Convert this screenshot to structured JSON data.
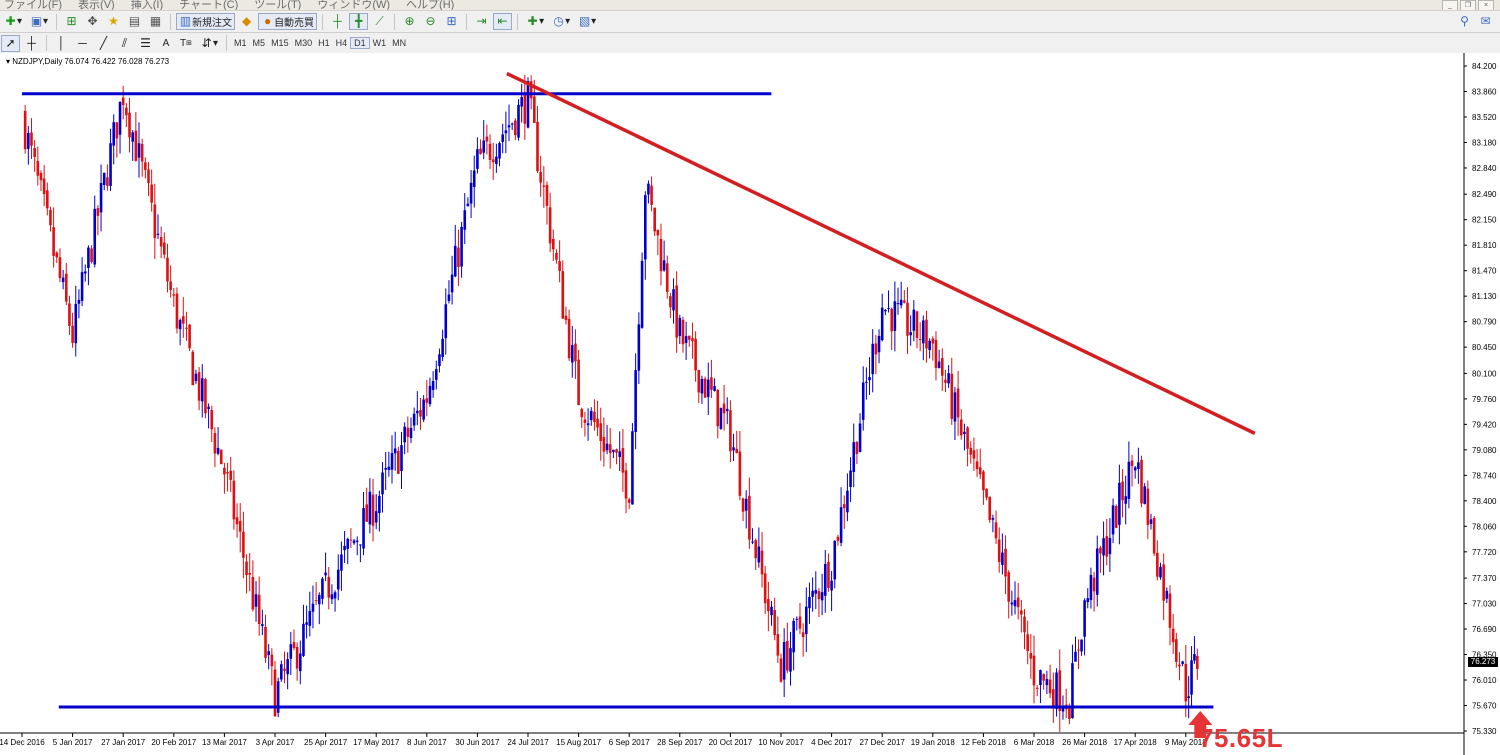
{
  "menu": [
    "ファイル(F)",
    "表示(V)",
    "挿入(I)",
    "チャート(C)",
    "ツール(T)",
    "ウィンドウ(W)",
    "ヘルプ(H)"
  ],
  "toolbar": {
    "new_order_label": "新規注文",
    "auto_trade_label": "自動売買"
  },
  "drawing_tools": {
    "text_tool_label": "A",
    "text_label_tool_label": "T"
  },
  "timeframes": [
    "M1",
    "M5",
    "M15",
    "M30",
    "H1",
    "H4",
    "D1",
    "W1",
    "MN"
  ],
  "active_timeframe": "D1",
  "chart_header": {
    "symbol_info": "NZDJPY,Daily  76.074 76.422 76.028 76.273"
  },
  "current_price_tag": "76.273",
  "annotation": {
    "text": "75.65L",
    "color": "#e53435"
  },
  "colors": {
    "bull_candle": "#0000cd",
    "bear_candle": "#dd1111",
    "support_resistance_line": "#0000cd",
    "trend_line": "#d41f22"
  },
  "chart_data": {
    "type": "candlestick",
    "symbol": "NZDJPY",
    "timeframe": "Daily",
    "ohlc_header": {
      "open": 76.074,
      "high": 76.422,
      "low": 76.028,
      "close": 76.273
    },
    "ylim": [
      75.33,
      84.2
    ],
    "y_ticks": [
      "84.200",
      "83.860",
      "83.520",
      "83.180",
      "82.840",
      "82.490",
      "82.150",
      "81.810",
      "81.470",
      "81.130",
      "80.790",
      "80.450",
      "80.100",
      "79.760",
      "79.420",
      "79.080",
      "78.740",
      "78.400",
      "78.060",
      "77.720",
      "77.370",
      "77.030",
      "76.690",
      "76.350",
      "76.010",
      "75.670",
      "75.330"
    ],
    "x_ticks": [
      "14 Dec 2016",
      "5 Jan 2017",
      "27 Jan 2017",
      "20 Feb 2017",
      "13 Mar 2017",
      "3 Apr 2017",
      "25 Apr 2017",
      "17 May 2017",
      "8 Jun 2017",
      "30 Jun 2017",
      "24 Jul 2017",
      "15 Aug 2017",
      "6 Sep 2017",
      "28 Sep 2017",
      "20 Oct 2017",
      "10 Nov 2017",
      "4 Dec 2017",
      "27 Dec 2017",
      "19 Jan 2018",
      "12 Feb 2018",
      "6 Mar 2018",
      "26 Mar 2018",
      "17 Apr 2018",
      "9 May 2018"
    ],
    "swing_points": [
      {
        "date": "14 Dec 2016",
        "price": 83.55
      },
      {
        "date": "5 Jan 2017",
        "price": 80.6
      },
      {
        "date": "27 Jan 2017",
        "price": 83.85
      },
      {
        "date": "20 Feb 2017",
        "price": 81.0
      },
      {
        "date": "13 Mar 2017",
        "price": 78.8
      },
      {
        "date": "3 Apr 2017",
        "price": 75.8
      },
      {
        "date": "25 Apr 2017",
        "price": 77.2
      },
      {
        "date": "17 May 2017",
        "price": 78.4
      },
      {
        "date": "8 Jun 2017",
        "price": 79.8
      },
      {
        "date": "30 Jun 2017",
        "price": 82.9
      },
      {
        "date": "24 Jul 2017",
        "price": 83.75
      },
      {
        "date": "15 Aug 2017",
        "price": 79.8
      },
      {
        "date": "6 Sep 2017",
        "price": 78.6
      },
      {
        "date": "13 Sep 2017",
        "price": 82.6
      },
      {
        "date": "28 Sep 2017",
        "price": 80.6
      },
      {
        "date": "20 Oct 2017",
        "price": 79.3
      },
      {
        "date": "10 Nov 2017",
        "price": 76.2
      },
      {
        "date": "4 Dec 2017",
        "price": 77.6
      },
      {
        "date": "27 Dec 2017",
        "price": 81.0
      },
      {
        "date": "19 Jan 2018",
        "price": 80.5
      },
      {
        "date": "12 Feb 2018",
        "price": 78.4
      },
      {
        "date": "6 Mar 2018",
        "price": 76.1
      },
      {
        "date": "20 Mar 2018",
        "price": 75.75
      },
      {
        "date": "26 Mar 2018",
        "price": 77.0
      },
      {
        "date": "17 Apr 2018",
        "price": 79.0
      },
      {
        "date": "9 May 2018",
        "price": 75.9
      },
      {
        "date": "14 May 2018",
        "price": 76.27
      }
    ],
    "horizontal_lines": [
      {
        "name": "resistance",
        "price": 83.83,
        "from": "14 Dec 2016",
        "to": "6 Nov 2017"
      },
      {
        "name": "support",
        "price": 75.65,
        "from": "30 Dec 2016",
        "to": "21 May 2018"
      }
    ],
    "trend_lines": [
      {
        "name": "descending-trendline",
        "from": {
          "date": "14 Jul 2017",
          "price": 84.1
        },
        "to": {
          "date": "8 Jun 2018",
          "price": 79.3
        }
      }
    ],
    "grid": false,
    "legend": "none"
  }
}
